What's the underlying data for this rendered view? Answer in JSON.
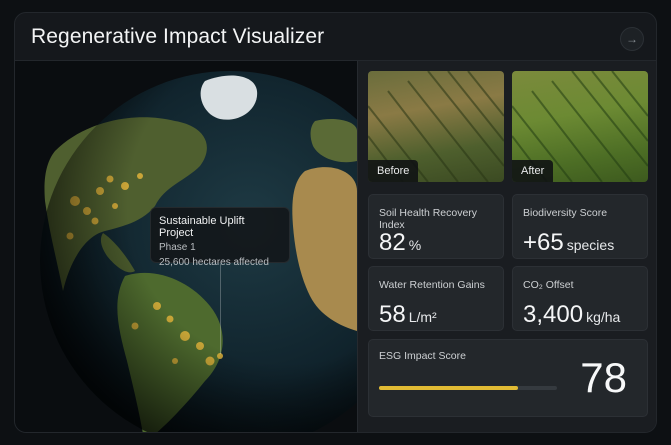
{
  "header": {
    "title": "Regenerative Impact Visualizer",
    "nav_icon": "arrow-right-icon"
  },
  "map": {
    "tooltip": {
      "title": "Sustainable Uplift Project",
      "phase": "Phase 1",
      "area": "25,600 hectares affected"
    },
    "colors": {
      "ocean": "#0e1a22",
      "land": "#4a5a2e",
      "highlight": "#e0b23a"
    }
  },
  "comparison": {
    "before_label": "Before",
    "after_label": "After"
  },
  "metrics": {
    "soil": {
      "label": "Soil Health Recovery Index",
      "value": "82",
      "unit": "%"
    },
    "biodiversity": {
      "label": "Biodiversity Score",
      "value": "+65",
      "unit": "species"
    },
    "water": {
      "label": "Water Retention Gains",
      "value": "58",
      "unit": "L/m²"
    },
    "co2": {
      "label": "CO₂ Offset",
      "value": "3,400",
      "unit": "kg/ha"
    }
  },
  "esg": {
    "label": "ESG Impact Score",
    "value": "78",
    "progress": 0.78,
    "bar_color": "#e1bb34"
  }
}
